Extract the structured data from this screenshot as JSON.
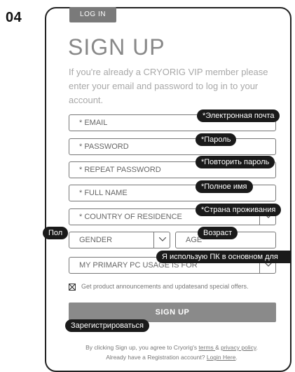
{
  "step_number": "04",
  "login_button": "LOG IN",
  "title": "SIGN UP",
  "intro": "If you're already a CRYORIG VIP member please enter your email and password to log in to your account.",
  "fields": {
    "email": "* EMAIL",
    "password": "* PASSWORD",
    "repeat_password": "* REPEAT PASSWORD",
    "full_name": "* FULL NAME",
    "country": "* COUNTRY OF RESIDENCE",
    "gender": "GENDER",
    "age": "AGE",
    "pc_usage": "MY PRIMARY PC USAGE IS FOR"
  },
  "annotations": {
    "email": "*Электронная почта",
    "password": "*Пароль",
    "repeat_password": "*Повторить пароль",
    "full_name": "*Полное имя",
    "country": "*Страна проживания",
    "gender": "Пол",
    "age": "Возраст",
    "pc_usage": "Я использую ПК в основном для",
    "signup": "Зарегистрироваться"
  },
  "checkbox_label": "Get product announcements and updatesand special offers.",
  "checkbox_checked": true,
  "signup_button": "SIGN UP",
  "terms": {
    "prefix": "By clicking Sign up, you agree to Cryorig's ",
    "terms_link": "terms ",
    "amp": "& ",
    "privacy_link": "privacy policy",
    "suffix": ".",
    "already": "Already have a Registration account? ",
    "login_link": "Login Here",
    "end": "."
  }
}
